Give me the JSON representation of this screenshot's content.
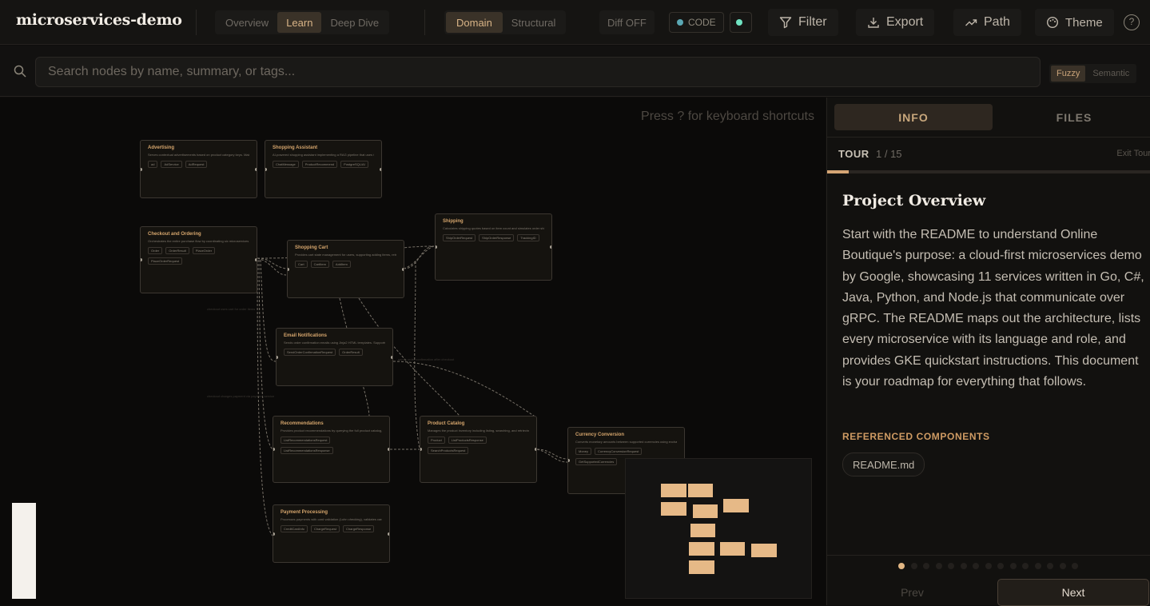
{
  "app": {
    "title": "microservices-demo"
  },
  "view_modes": {
    "items": [
      "Overview",
      "Learn",
      "Deep Dive"
    ],
    "active": "Learn"
  },
  "graph_modes": {
    "items": [
      "Domain",
      "Structural"
    ],
    "active": "Domain"
  },
  "diff": {
    "label": "Diff OFF"
  },
  "code_toggle": {
    "label": "CODE",
    "dot_color": "#5aa7b3"
  },
  "extra_toggle": {
    "dot_color": "#70e3c2"
  },
  "toolbar": {
    "filter": "Filter",
    "export": "Export",
    "path": "Path",
    "theme": "Theme",
    "help": "?"
  },
  "search": {
    "placeholder": "Search nodes by name, summary, or tags...",
    "modes": [
      "Fuzzy",
      "Semantic"
    ],
    "active_mode": "Fuzzy"
  },
  "canvas": {
    "hint": "Press ? for keyboard shortcuts"
  },
  "graph": {
    "nodes": [
      {
        "title": "Advertising",
        "summary": "Serves contextual advertisements based on product category keys. Maintains an in-memory map of...",
        "tags": [
          "ad",
          "AdService",
          "AdRequest"
        ]
      },
      {
        "title": "Shopping Assistant",
        "summary": "AI-powered shopping assistant implementing a RAG pipeline that uses Gemini vision to analyze room...",
        "tags": [
          "ChatMessage",
          "ProductRecommend",
          "PostgreSQL/AI"
        ]
      },
      {
        "title": "Checkout and Ordering",
        "summary": "Orchestrates the entire purchase flow by coordinating six microservices that form the order pipeline...",
        "tags": [
          "Order",
          "OrderResult",
          "PlaceOrder",
          "PlaceOrderRequest"
        ]
      },
      {
        "title": "Shopping Cart",
        "summary": "Provides cart state management for users, supporting adding items, retrieving cart contents...",
        "tags": [
          "Cart",
          "CartItem",
          "AddItem"
        ]
      },
      {
        "title": "Shipping",
        "summary": "Calculates shipping quotes based on item count and simulates order shipment by generating tracking ID...",
        "tags": [
          "ShipOrderRequest",
          "ShipOrderResponse",
          "TrackingID"
        ]
      },
      {
        "title": "Email Notifications",
        "summary": "Sends order confirmation emails using Jinja2 HTML templates. Supports a dummy mode for development...",
        "tags": [
          "SendOrderConfirmationRequest",
          "OrderResult"
        ]
      },
      {
        "title": "Recommendations",
        "summary": "Provides product recommendations by querying the full product catalog, filtering out items the user...",
        "tags": [
          "ListRecommendationsRequest",
          "ListRecommendationsResponse"
        ]
      },
      {
        "title": "Product Catalog",
        "summary": "Manages the product inventory including listing, searching, and retrieving individual product details...",
        "tags": [
          "Product",
          "ListProductsResponse",
          "SearchProductsRequest"
        ]
      },
      {
        "title": "Currency Conversion",
        "summary": "Converts monetary amounts between supported currencies using exchange rate data from the European...",
        "tags": [
          "Money",
          "CurrencyConversionRequest",
          "GetSupportedCurrencies"
        ]
      },
      {
        "title": "Payment Processing",
        "summary": "Processes payments with card validation (Luhn checking), validates card numbers (Visa/MasterCard only)...",
        "tags": [
          "CreditCardInfo",
          "ChargeRequest",
          "ChargeResponse"
        ]
      }
    ],
    "edge_labels": [
      "checkout uses cart for order items",
      "sends order confirmation after checkout",
      "checkout charges payment via payment service"
    ]
  },
  "panel": {
    "tabs": [
      "INFO",
      "FILES"
    ],
    "active_tab": "INFO",
    "tour_label": "TOUR",
    "tour_count": "1 / 15",
    "tour_progress": 0.0667,
    "exit_tour": "Exit Tour",
    "title": "Project Overview",
    "body": "Start with the README to understand Online Boutique's purpose: a cloud-first microservices demo by Google, showcasing 11 services written in Go, C#, Java, Python, and Node.js that communicate over gRPC. The README maps out the architecture, lists every microservice with its language and role, and provides GKE quickstart instructions. This document is your roadmap for everything that follows.",
    "ref_title": "REFERENCED COMPONENTS",
    "ref_chip": "README.md",
    "steps_total": 15,
    "step_current": 1,
    "prev": "Prev",
    "next": "Next"
  },
  "colors": {
    "accent": "#d6a66d",
    "minimap_box": "#e6b987"
  }
}
